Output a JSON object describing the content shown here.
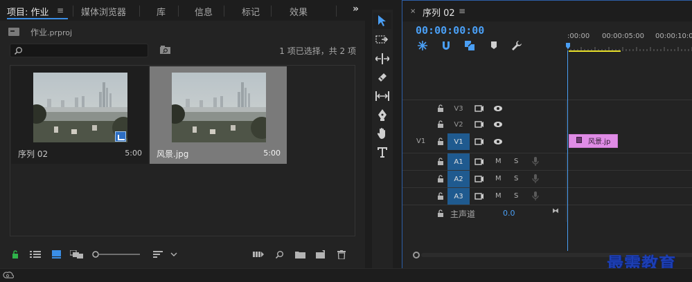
{
  "project_panel": {
    "tabs": [
      {
        "label": "项目: 作业",
        "active": true
      },
      {
        "label": "媒体浏览器",
        "active": false
      },
      {
        "label": "库",
        "active": false
      },
      {
        "label": "信息",
        "active": false
      },
      {
        "label": "标记",
        "active": false
      },
      {
        "label": "效果",
        "active": false
      }
    ],
    "project_name": "作业",
    "project_ext": ".prproj",
    "search": {
      "placeholder": "",
      "value": ""
    },
    "selection_info": "1 项已选择，共 2 项",
    "items": [
      {
        "name": "序列 02",
        "duration": "5:00",
        "type": "sequence",
        "selected": false
      },
      {
        "name": "风景.jpg",
        "duration": "5:00",
        "type": "still",
        "selected": true
      }
    ]
  },
  "tools": [
    "selection-tool",
    "track-select-forward-tool",
    "ripple-edit-tool",
    "razor-tool",
    "slip-tool",
    "pen-tool",
    "hand-tool",
    "type-tool"
  ],
  "timeline": {
    "tab_label": "序列 02",
    "close_glyph": "×",
    "timecode": "00:00:00:00",
    "ruler_labels": [
      ":00:00",
      "00:00:05:00",
      "00:00:10:00"
    ],
    "video_tracks": [
      {
        "label": "V3",
        "source": "",
        "targeted": false
      },
      {
        "label": "V2",
        "source": "",
        "targeted": false
      },
      {
        "label": "V1",
        "source": "V1",
        "targeted": true
      }
    ],
    "audio_tracks": [
      {
        "label": "A1",
        "mute": "M",
        "solo": "S",
        "targeted": true
      },
      {
        "label": "A2",
        "mute": "M",
        "solo": "S",
        "targeted": true
      },
      {
        "label": "A3",
        "mute": "M",
        "solo": "S",
        "targeted": true
      }
    ],
    "master": {
      "label": "主声道",
      "value": "0.0"
    },
    "clip": {
      "name": "风景.jp",
      "track": "V1",
      "color": "#e08ce6"
    }
  },
  "watermark": "最需教育",
  "colors": {
    "accent": "#4a9ff5",
    "target_track": "#1f5a8f",
    "clip_pink": "#e08ce6",
    "work_area": "#e8e02a",
    "selected_card": "#7a7a7a",
    "watermark": "#1d3fb4"
  }
}
